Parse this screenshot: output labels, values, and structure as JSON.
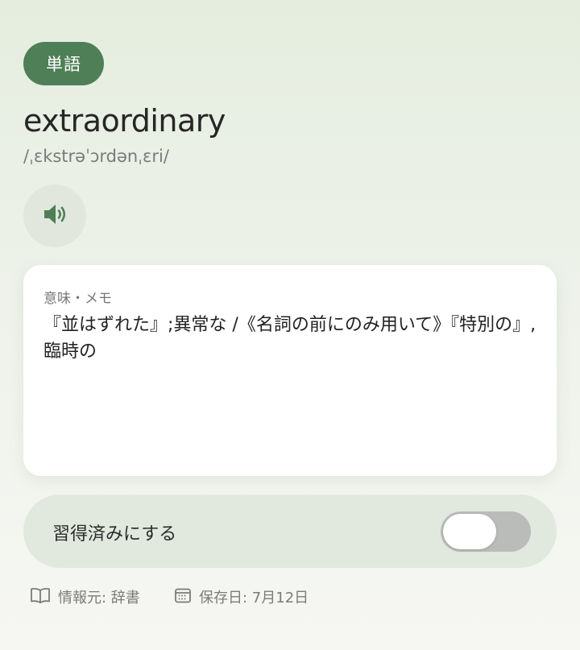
{
  "header": {
    "badge": "単語"
  },
  "entry": {
    "word": "extraordinary",
    "pronunciation": "/ˌɛkstrəˈɔrdənˌɛri/"
  },
  "audio": {
    "icon": "speaker-icon"
  },
  "meaning_card": {
    "label": "意味・メモ",
    "text": "『並はずれた』;異常な /《名詞の前にのみ用いて》『特別の』,臨時の"
  },
  "learned": {
    "label": "習得済みにする",
    "checked": false
  },
  "footer": {
    "source": "情報元: 辞書",
    "saved_date": "保存日: 7月12日"
  },
  "colors": {
    "accent": "#4f7f57",
    "toggle_row_bg": "#e1e8dd",
    "switch_off": "#b9bcb8"
  }
}
